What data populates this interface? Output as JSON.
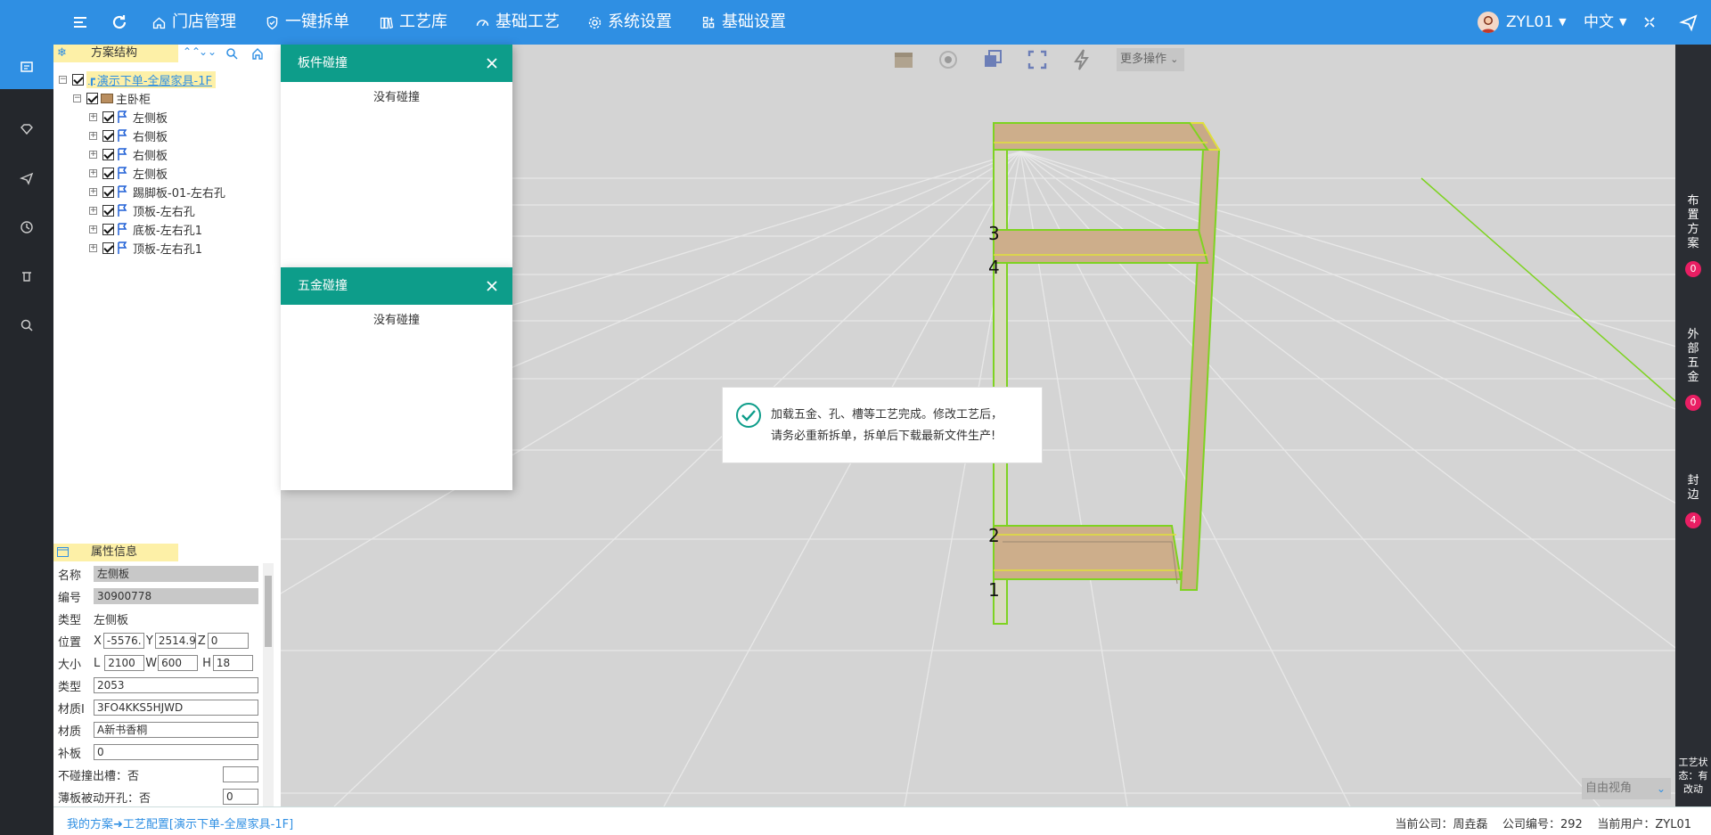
{
  "topbar": {
    "nav": [
      {
        "label": "门店管理",
        "icon": "home-icon"
      },
      {
        "label": "一键拆单",
        "icon": "shield-check-icon"
      },
      {
        "label": "工艺库",
        "icon": "book-icon"
      },
      {
        "label": "基础工艺",
        "icon": "gauge-icon"
      },
      {
        "label": "系统设置",
        "icon": "gear-icon"
      },
      {
        "label": "基础设置",
        "icon": "grid-plus-icon"
      }
    ],
    "user": "ZYL01",
    "language": "中文"
  },
  "tree": {
    "title": "方案结构",
    "root": "演示下单-全屋家具-1F",
    "cabinet": "主卧柜",
    "parts": [
      "左侧板",
      "右侧板",
      "右侧板",
      "左侧板",
      "踢脚板-01-左右孔",
      "顶板-左右孔",
      "底板-左右孔1",
      "顶板-左右孔1"
    ]
  },
  "properties": {
    "title": "属性信息",
    "name_label": "名称",
    "name_value": "左侧板",
    "code_label": "编号",
    "code_value": "30900778",
    "type_label": "类型",
    "type_value": "左侧板",
    "pos_label": "位置",
    "x_label": "X",
    "x_value": "-5576.",
    "y_label": "Y",
    "y_value": "2514.9",
    "z_label": "Z",
    "z_value": "0",
    "size_label": "大小",
    "l_label": "L",
    "l_value": "2100",
    "w_label": "W",
    "w_value": "600",
    "h_label": "H",
    "h_value": "18",
    "type2_label": "类型",
    "type2_value": "2053",
    "matid_label": "材质I",
    "matid_value": "3FO4KKS5HJWD",
    "mat_label": "材质",
    "mat_value": "A新书香桐",
    "patch_label": "补板",
    "patch_value": "0",
    "nocollide_label": "不碰撞出槽：否",
    "thin_label": "薄板被动开孔：否",
    "thin_value": "0"
  },
  "popups": {
    "board": {
      "title": "板件碰撞",
      "body": "没有碰撞"
    },
    "hardware": {
      "title": "五金碰撞",
      "body": "没有碰撞"
    }
  },
  "viewport": {
    "more_ops": "更多操作",
    "view_mode": "自由视角",
    "markers": [
      "3",
      "4",
      "2",
      "1"
    ]
  },
  "toast": {
    "line1": "加载五金、孔、槽等工艺完成。修改工艺后，",
    "line2": "请务必重新拆单，拆单后下载最新文件生产!"
  },
  "rightrail": {
    "layout": "布置方案",
    "layout_count": "0",
    "hardware": "外部五金",
    "hardware_count": "0",
    "edge": "封边",
    "edge_count": "4",
    "status": "工艺状态：有改动"
  },
  "statusbar": {
    "crumb": "我的方案➜工艺配置[演示下单-全屋家具-1F]",
    "company": "当前公司：周垚磊",
    "company_no": "公司编号：292",
    "user": "当前用户：ZYL01"
  }
}
